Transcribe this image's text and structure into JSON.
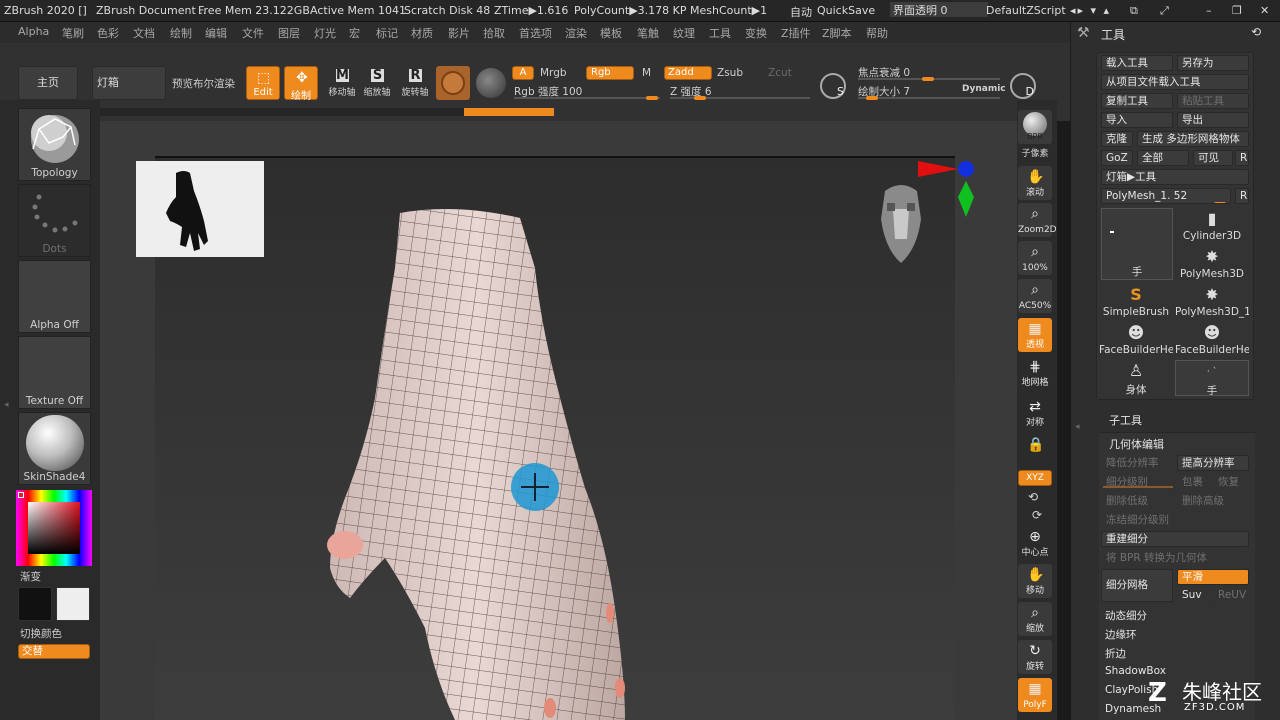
{
  "titlebar": {
    "app": "ZBrush 2020 []",
    "document": "ZBrush Document ..",
    "free_mem": "Free Mem 23.122GB",
    "active_mem": "Active Mem 1041",
    "scratch": "Scratch Disk 48",
    "ztime": "ZTime▶1.616",
    "polycount": "PolyCount▶3.178 KP",
    "meshcount": "MeshCount▶1",
    "auto": "自动",
    "quicksave": "QuickSave",
    "transparency": "界面透明 0",
    "script": "DefaultZScript"
  },
  "menu": [
    "Alpha",
    "笔刷",
    "色彩",
    "文档",
    "绘制",
    "编辑",
    "文件",
    "图层",
    "灯光",
    "宏",
    "标记",
    "材质",
    "影片",
    "拾取",
    "首选项",
    "渲染",
    "模板",
    "笔触",
    "纹理",
    "工具",
    "变换",
    "Z插件",
    "Z脚本",
    "帮助"
  ],
  "topshelf": {
    "home": "主页",
    "lightbox": "灯箱",
    "preview_render": "预览布尔渲染",
    "edit": "Edit",
    "draw": "绘制",
    "move": "移动轴",
    "scale": "缩放轴",
    "rotate": "旋转轴",
    "a": "A",
    "mrgb": "Mrgb",
    "rgb": "Rgb",
    "m": "M",
    "zadd": "Zadd",
    "zsub": "Zsub",
    "zcut": "Zcut",
    "rgb_intensity": "Rgb 强度 100",
    "z_intensity": "Z 强度 6",
    "s_label": "S",
    "focal_shift": "焦点衰减 0",
    "draw_size": "绘制大小 7",
    "dynamic": "Dynamic",
    "d_label": "D"
  },
  "leftshelf": {
    "brush": "Topology",
    "stroke": "Dots",
    "alpha": "Alpha Off",
    "texture": "Texture Off",
    "material": "SkinShade4",
    "gradient": "渐变",
    "switch_color": "切换颜色",
    "alternate": "交替"
  },
  "rightshelf": {
    "bpr": "BPR",
    "subpixel": "子像素",
    "scroll": "滚动",
    "zoom2d": "Zoom2D",
    "p100": "100%",
    "ac50": "AC50%",
    "persp": "透视",
    "floor": "地网格",
    "sym": "对称",
    "xyz": "XYZ",
    "center": "中心点",
    "move": "移动",
    "zoom": "缩放",
    "rotate": "旋转",
    "polyf": "PolyF"
  },
  "panel": {
    "title": "工具",
    "load_tool": "载入工具",
    "save_as": "另存为",
    "load_from_project": "从项目文件载入工具",
    "copy_tool": "复制工具",
    "paste_tool": "粘贴工具",
    "import": "导入",
    "export": "导出",
    "clone": "克隆",
    "make_polymesh": "生成 多边形网格物体",
    "goz": "GoZ",
    "all": "全部",
    "visible": "可见",
    "r": "R",
    "lightbox_tools": "灯箱▶工具",
    "polymesh_name": "PolyMesh_1. 52",
    "tools": [
      "Cylinder3D",
      "PolyMesh3D",
      "SimpleBrush",
      "PolyMesh3D_1",
      "FaceBuilderHe",
      "FaceBuilderHe",
      "身体",
      "手"
    ],
    "current_tool": "手",
    "subtool": "子工具",
    "geometry": "几何体编辑",
    "lower_res": "降低分辨率",
    "higher_res": "提高分辨率",
    "sdiv": "细分级别",
    "cage": "包裹",
    "rstr": "恢复",
    "del_lower": "删除低级",
    "del_higher": "删除高级",
    "freeze_sdiv": "冻结细分级别",
    "reconstruct": "重建细分",
    "bpr_to_geo": "将 BPR 转换为几何体",
    "divide": "细分网格",
    "smooth": "平滑",
    "suv": "Suv",
    "reuv": "ReUV",
    "dynamic_sub": "动态细分",
    "edgeloop": "边缘环",
    "crease": "折边",
    "shadowbox": "ShadowBox",
    "claypolish": "ClayPolish",
    "dynamesh": "Dynamesh"
  },
  "watermark": {
    "text": "朱峰社区",
    "sub": "ZF3D.COM"
  },
  "colors": {
    "accent": "#ef8a1e",
    "panel": "#2e2e2e",
    "viewport": "#3a3a3a"
  }
}
